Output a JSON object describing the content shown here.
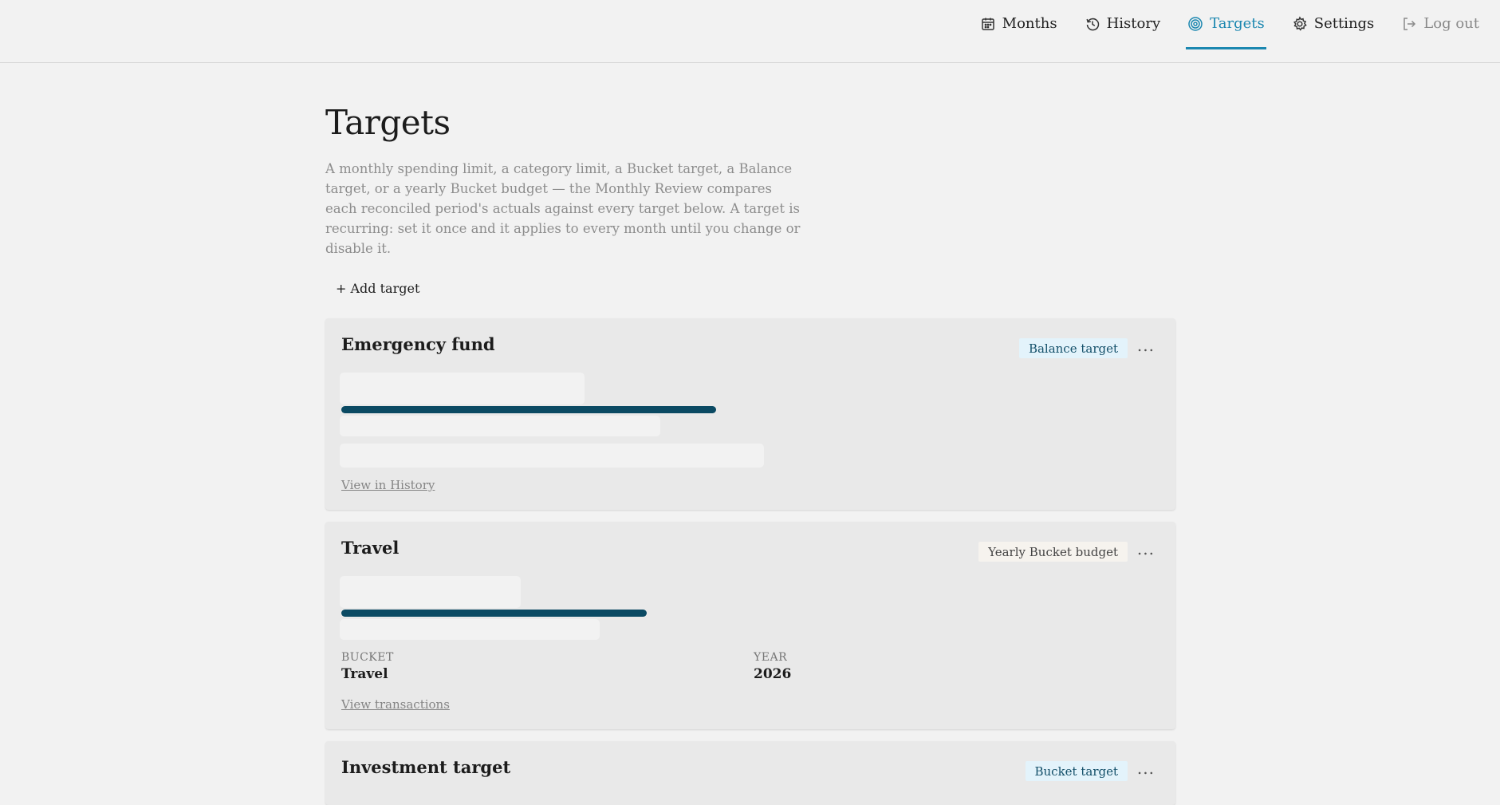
{
  "nav": {
    "items": [
      {
        "label": "Months",
        "icon": "calendar-icon"
      },
      {
        "label": "History",
        "icon": "history-icon"
      },
      {
        "label": "Targets",
        "icon": "target-icon",
        "active": true
      },
      {
        "label": "Settings",
        "icon": "gear-icon"
      },
      {
        "label": "Log out",
        "icon": "logout-icon"
      }
    ]
  },
  "colors": {
    "accent": "#1b87b0",
    "progress": "#0b4a63",
    "balance_badge_bg": "#e3f3fb",
    "yearly_badge_bg": "#f6f3ee"
  },
  "page": {
    "title": "Targets",
    "description": "A monthly spending limit, a category limit, a Bucket target, a Balance target, or a yearly Bucket budget — the Monthly Review compares each reconciled period's actuals against every target below. A target is recurring: set it once and it applies to every month until you change or disable it.",
    "add_label": "+ Add target"
  },
  "cards": [
    {
      "title": "Emergency fund",
      "badge": "Balance target",
      "more": "...",
      "progress": 0.81,
      "link": "View in History"
    },
    {
      "title": "Travel",
      "badge": "Yearly Bucket budget",
      "more": "...",
      "progress": 0.66,
      "bucket_label": "BUCKET",
      "bucket_value": "Travel",
      "year_label": "YEAR",
      "year_value": "2026",
      "link": "View transactions"
    },
    {
      "title": "Investment target",
      "badge": "Bucket target",
      "more": "..."
    }
  ]
}
